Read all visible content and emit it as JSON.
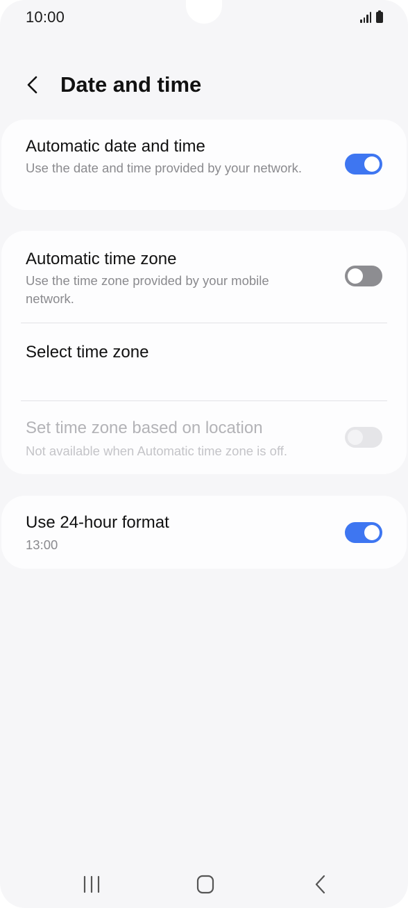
{
  "status_bar": {
    "time": "10:00",
    "icons": [
      "signal-icon",
      "battery-icon"
    ]
  },
  "header": {
    "back_icon": "chevron-left-icon",
    "title": "Date and time"
  },
  "settings": {
    "auto_date_time": {
      "title": "Automatic date and time",
      "subtitle": "Use the date and time provided by your network.",
      "enabled": true
    },
    "auto_time_zone": {
      "title": "Automatic time zone",
      "subtitle": "Use the time zone provided by your mobile network.",
      "enabled": false
    },
    "select_time_zone": {
      "title": "Select time zone"
    },
    "location_time_zone": {
      "title": "Set time zone based on location",
      "subtitle": "Not available when Automatic time zone is off.",
      "enabled": false,
      "available": false
    },
    "format_24h": {
      "title": "Use 24-hour format",
      "subtitle": "13:00",
      "enabled": true
    }
  },
  "nav_bar": {
    "icons": [
      "recents-icon",
      "home-icon",
      "back-nav-icon"
    ]
  },
  "colors": {
    "accent": "#3e76f1",
    "toggle_off": "#8d8d91",
    "background": "#f6f6f8",
    "card": "#fdfdfe"
  }
}
